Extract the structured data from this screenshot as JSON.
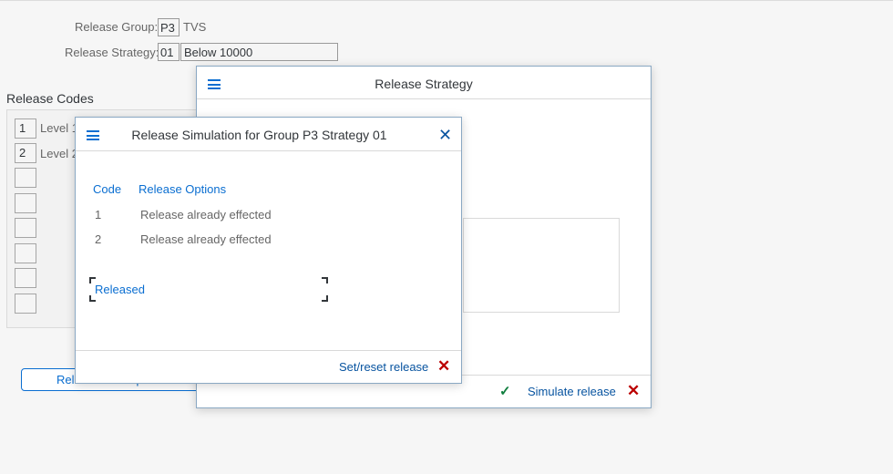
{
  "header": {
    "release_group_label": "Release Group:",
    "release_group_code": "P3",
    "release_group_text": "TVS",
    "release_strategy_label": "Release Strategy:",
    "release_strategy_code": "01",
    "release_strategy_text": "Below 10000"
  },
  "release_codes": {
    "title": "Release Codes",
    "rows": [
      {
        "code": "1",
        "label": "Level 1"
      },
      {
        "code": "2",
        "label": "Level 2"
      },
      {
        "code": "",
        "label": ""
      },
      {
        "code": "",
        "label": ""
      },
      {
        "code": "",
        "label": ""
      },
      {
        "code": "",
        "label": ""
      },
      {
        "code": "",
        "label": ""
      },
      {
        "code": "",
        "label": ""
      }
    ]
  },
  "background_button": {
    "label": "Release Prerequisites"
  },
  "strategy_dialog": {
    "title": "Release Strategy",
    "menu_icon": "hamburger-menu-icon",
    "simulate_label": "Simulate release",
    "confirm_icon": "checkmark-icon",
    "cancel_icon": "close-icon"
  },
  "simulation_dialog": {
    "title": "Release Simulation for Group P3 Strategy 01",
    "menu_icon": "hamburger-menu-icon",
    "close_icon": "close-icon",
    "columns": [
      "Code",
      "Release Options"
    ],
    "rows": [
      {
        "code": "1",
        "option": "Release already effected"
      },
      {
        "code": "2",
        "option": "Release already effected"
      }
    ],
    "status_link": "Released",
    "footer_action": "Set/reset release",
    "cancel_icon": "close-icon"
  },
  "colors": {
    "accent": "#0a6ed1",
    "accept": "#107e3e",
    "reject": "#bb0000"
  }
}
